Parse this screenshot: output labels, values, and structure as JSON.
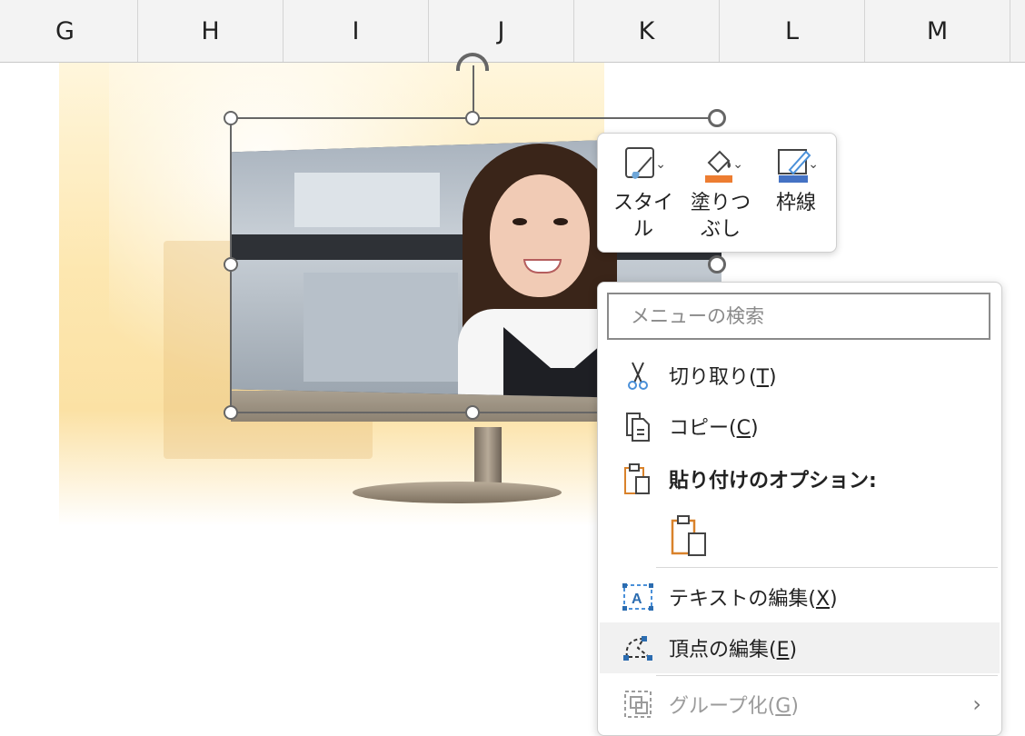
{
  "columns": [
    "G",
    "H",
    "I",
    "J",
    "K",
    "L",
    "M"
  ],
  "mini_toolbar": {
    "style_label_1": "スタイ",
    "style_label_2": "ル",
    "fill_label_1": "塗りつ",
    "fill_label_2": "ぶし",
    "outline_label": "枠線",
    "fill_color": "#ed7d31",
    "outline_color": "#4472c4"
  },
  "context_menu": {
    "search_placeholder": "メニューの検索",
    "cut": {
      "text": "切り取り(",
      "key": "T",
      "end": ")"
    },
    "copy": {
      "text": "コピー(",
      "key": "C",
      "end": ")"
    },
    "paste_options": "貼り付けのオプション:",
    "edit_text": {
      "text": "テキストの編集(",
      "key": "X",
      "end": ")"
    },
    "edit_points": {
      "text": "頂点の編集(",
      "key": "E",
      "end": ")"
    },
    "group": {
      "text": "グループ化(",
      "key": "G",
      "end": ")"
    }
  }
}
